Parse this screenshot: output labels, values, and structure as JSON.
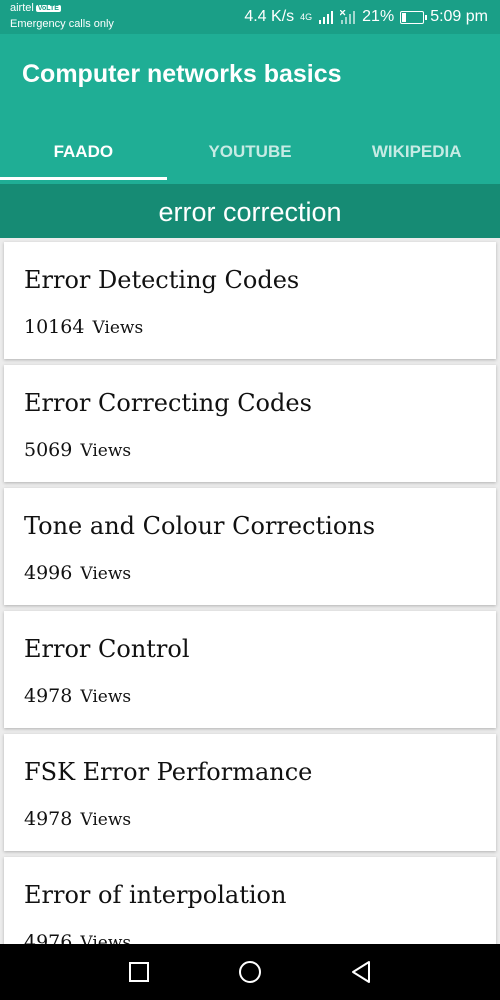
{
  "status_bar": {
    "carrier": "airtel",
    "volte": "VoLTE",
    "emergency": "Emergency calls only",
    "speed": "4.4 K/s",
    "network": "4G",
    "battery": "21%",
    "battery_level": 0.21,
    "time": "5:09 pm"
  },
  "app": {
    "title": "Computer networks basics"
  },
  "tabs": [
    {
      "label": "FAADO",
      "active": true
    },
    {
      "label": "YOUTUBE",
      "active": false
    },
    {
      "label": "WIKIPEDIA",
      "active": false
    }
  ],
  "section": {
    "title": "error correction"
  },
  "items": [
    {
      "title": "Error Detecting Codes",
      "views": "10164",
      "views_label": "Views"
    },
    {
      "title": "Error Correcting Codes",
      "views": "5069",
      "views_label": "Views"
    },
    {
      "title": "Tone and Colour Corrections",
      "views": "4996",
      "views_label": "Views"
    },
    {
      "title": "Error Control",
      "views": "4978",
      "views_label": "Views"
    },
    {
      "title": "FSK Error Performance",
      "views": "4978",
      "views_label": "Views"
    },
    {
      "title": "Error of interpolation",
      "views": "4976",
      "views_label": "Views"
    }
  ],
  "nav_icons": [
    "recent-apps-icon",
    "home-icon",
    "back-icon"
  ]
}
